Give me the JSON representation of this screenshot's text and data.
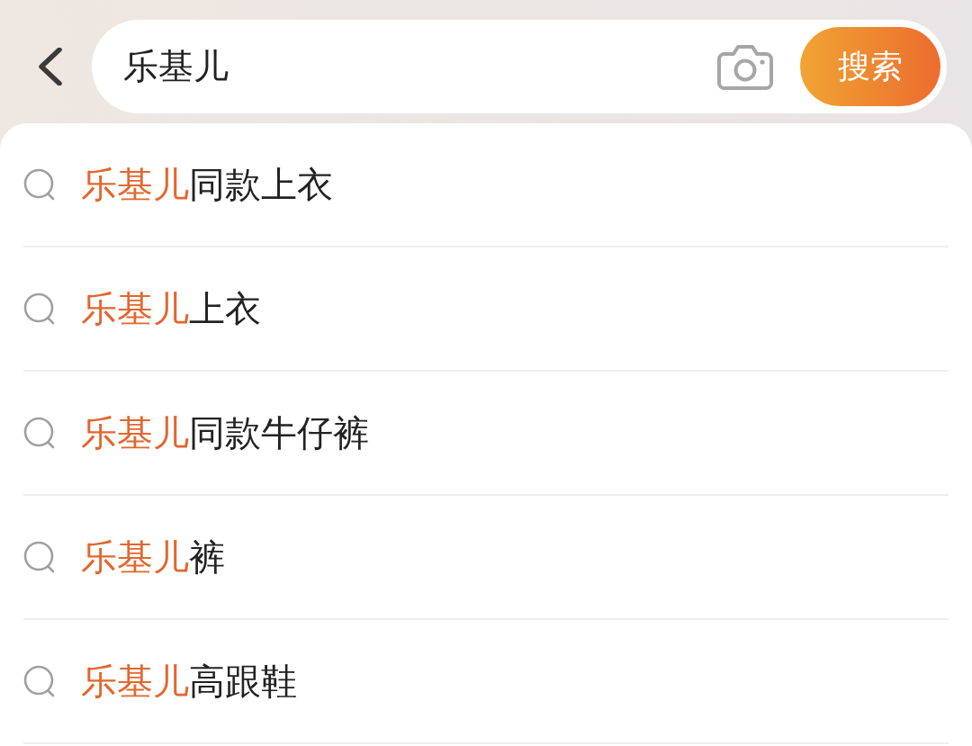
{
  "header": {
    "query": "乐基儿",
    "search_button": "搜索"
  },
  "suggestions": [
    {
      "highlight": "乐基儿",
      "rest": "同款上衣"
    },
    {
      "highlight": "乐基儿",
      "rest": "上衣"
    },
    {
      "highlight": "乐基儿",
      "rest": "同款牛仔裤"
    },
    {
      "highlight": "乐基儿",
      "rest": "裤"
    },
    {
      "highlight": "乐基儿",
      "rest": "高跟鞋"
    }
  ]
}
